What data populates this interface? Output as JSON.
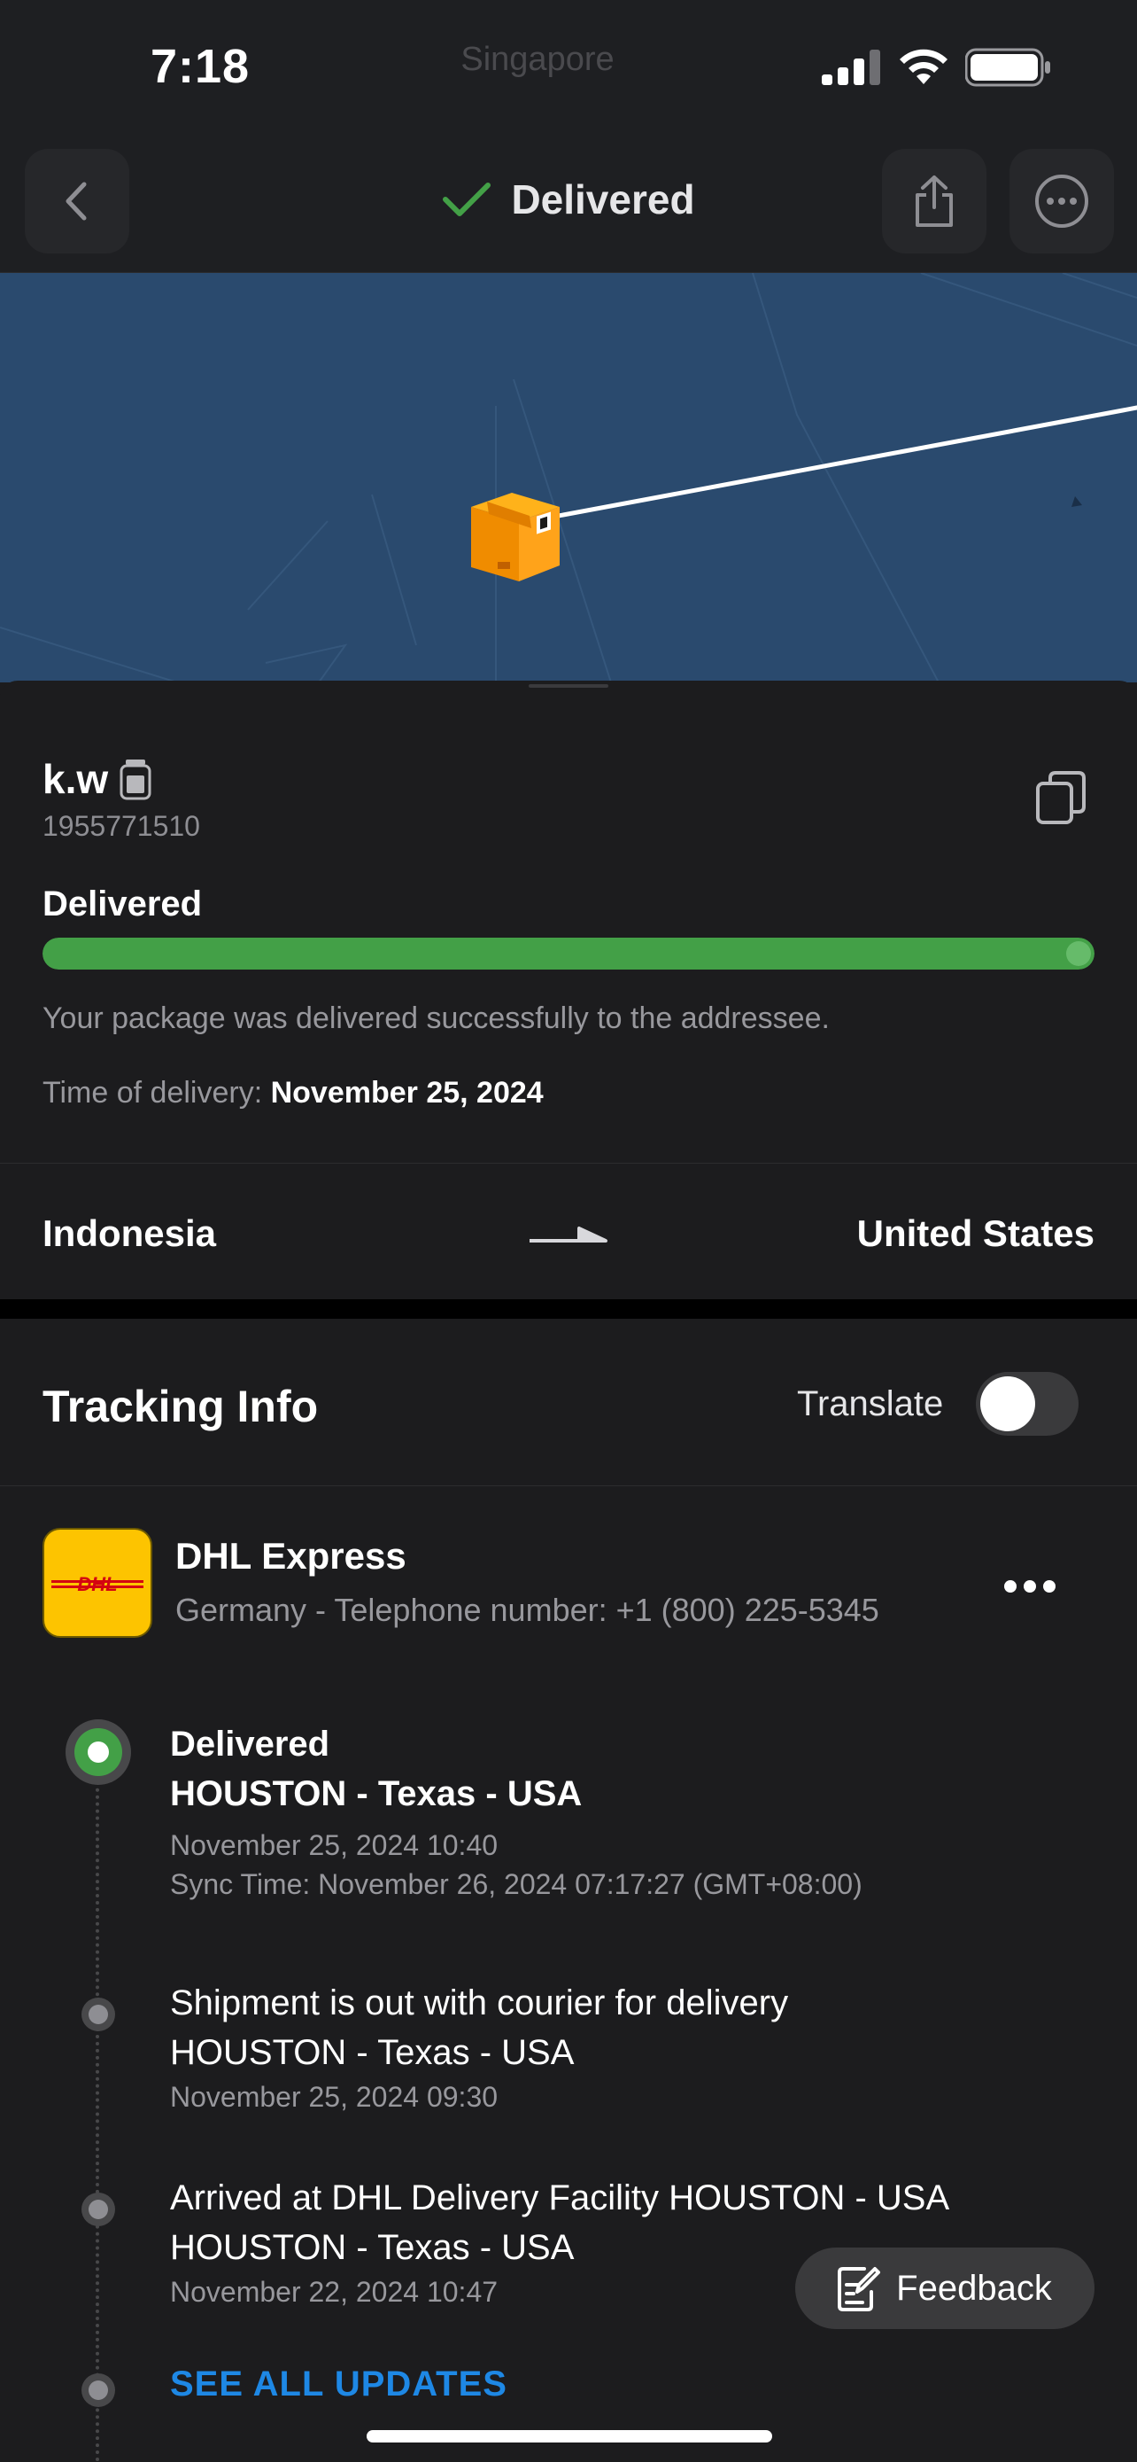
{
  "status_bar": {
    "time": "7:18",
    "location": "Singapore",
    "icons": [
      "signal-icon",
      "wifi-icon",
      "battery-icon"
    ]
  },
  "nav": {
    "title": "Delivered",
    "title_icon": "checkmark-icon",
    "back_icon": "chevron-left-icon",
    "share_icon": "share-icon",
    "more_icon": "more-circle-icon"
  },
  "map": {
    "marker_icon": "package-box-icon"
  },
  "package": {
    "name": "k.w",
    "name_icon": "jar-icon",
    "number": "1955771510",
    "status_title": "Delivered",
    "progress": 1.0,
    "description": "Your package was delivered successfully to the addressee.",
    "time_label": "Time of delivery:",
    "time_value": "November 25, 2024",
    "origin": "Indonesia",
    "destination": "United States"
  },
  "tracking": {
    "title": "Tracking Info",
    "translate_label": "Translate",
    "translate_on": false,
    "carrier": {
      "logo_text": "DHL",
      "name": "DHL Express",
      "phone": "Germany - Telephone number: +1 (800) 225-5345"
    },
    "events": [
      {
        "status": "Delivered",
        "location": "HOUSTON - Texas - USA",
        "date": "November 25, 2024 10:40",
        "sync": "Sync Time: November 26, 2024 07:17:27 (GMT+08:00)"
      },
      {
        "status": "Shipment is out with courier for delivery",
        "location": "HOUSTON - Texas - USA",
        "date": "November 25, 2024 09:30"
      },
      {
        "status": "Arrived at DHL Delivery Facility HOUSTON - USA",
        "location": "HOUSTON - Texas - USA",
        "date": "November 22, 2024 10:47"
      }
    ],
    "see_all_label": "SEE ALL UPDATES"
  },
  "feedback": {
    "label": "Feedback",
    "icon": "edit-note-icon"
  },
  "colors": {
    "accent_green": "#43a047",
    "link_blue": "#1e88e5",
    "dhl_yellow": "#fdc400",
    "dhl_red": "#d40511",
    "map_blue": "#2a4a6e"
  }
}
